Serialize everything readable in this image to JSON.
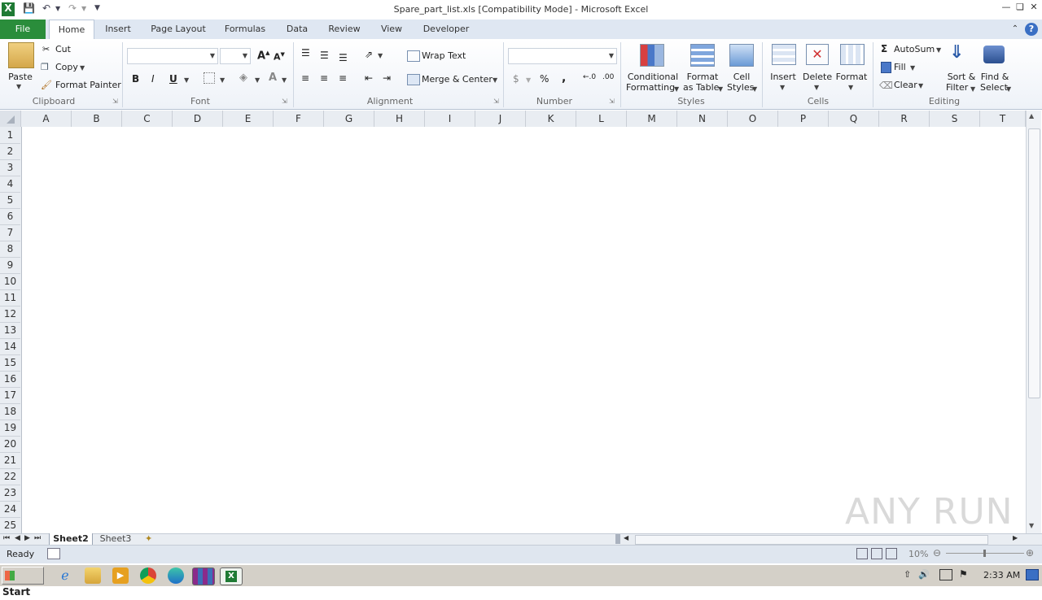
{
  "window": {
    "title": "Spare_part_list.xls  [Compatibility Mode]  -  Microsoft Excel"
  },
  "tabs": [
    {
      "label": "File"
    },
    {
      "label": "Home"
    },
    {
      "label": "Insert"
    },
    {
      "label": "Page Layout"
    },
    {
      "label": "Formulas"
    },
    {
      "label": "Data"
    },
    {
      "label": "Review"
    },
    {
      "label": "View"
    },
    {
      "label": "Developer"
    }
  ],
  "ribbon": {
    "clipboard": {
      "paste": "Paste",
      "cut": "Cut",
      "copy": "Copy",
      "format_painter": "Format Painter",
      "label": "Clipboard"
    },
    "font": {
      "bold": "B",
      "italic": "I",
      "underline": "U",
      "label": "Font"
    },
    "alignment": {
      "wrap_text": "Wrap Text",
      "merge_center": "Merge & Center",
      "label": "Alignment"
    },
    "number": {
      "currency": "$",
      "percent": "%",
      "comma": ",",
      "label": "Number"
    },
    "styles": {
      "conditional_1": "Conditional",
      "conditional_2": "Formatting",
      "format_table_1": "Format",
      "format_table_2": "as Table",
      "cell_styles_1": "Cell",
      "cell_styles_2": "Styles",
      "label": "Styles"
    },
    "cells": {
      "insert": "Insert",
      "delete": "Delete",
      "format": "Format",
      "label": "Cells"
    },
    "editing": {
      "autosum": "AutoSum",
      "fill": "Fill",
      "clear": "Clear",
      "sort_1": "Sort &",
      "sort_2": "Filter",
      "find_1": "Find &",
      "find_2": "Select",
      "label": "Editing"
    }
  },
  "columns": [
    "A",
    "B",
    "C",
    "D",
    "E",
    "F",
    "G",
    "H",
    "I",
    "J",
    "K",
    "L",
    "M",
    "N",
    "O",
    "P",
    "Q",
    "R",
    "S",
    "T"
  ],
  "rows": [
    "1",
    "2",
    "3",
    "4",
    "5",
    "6",
    "7",
    "8",
    "9",
    "10",
    "11",
    "12",
    "13",
    "14",
    "15",
    "16",
    "17",
    "18",
    "19",
    "20",
    "21",
    "22",
    "23",
    "24",
    "25"
  ],
  "sheets": [
    {
      "label": "Sheet2",
      "active": true
    },
    {
      "label": "Sheet3",
      "active": false
    }
  ],
  "status": {
    "text": "Ready",
    "zoom": "10%"
  },
  "taskbar": {
    "start": "Start",
    "time": "2:33 AM"
  },
  "watermark": "ANY RUN"
}
